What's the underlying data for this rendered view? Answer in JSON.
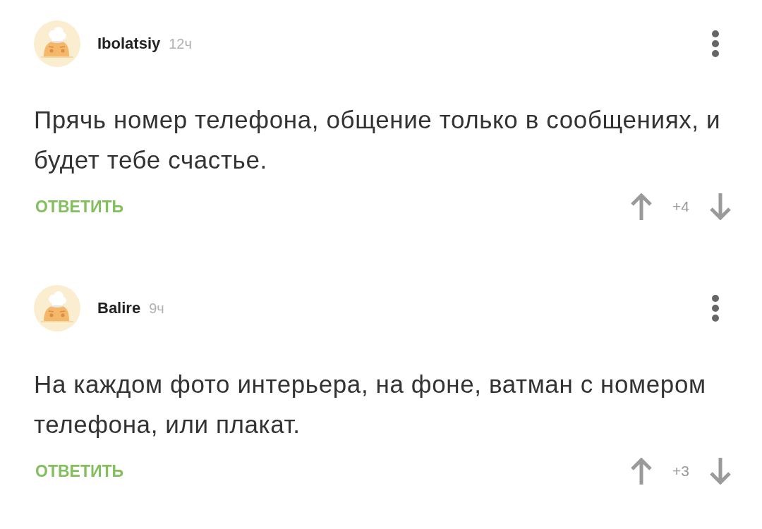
{
  "comments": [
    {
      "author": "Ibolatsiy",
      "time": "12ч",
      "text": "Прячь номер телефона, общение только в сообщениях, и будет тебе счастье.",
      "reply_label": "ОТВЕТИТЬ",
      "rating": "+4"
    },
    {
      "author": "Balire",
      "time": "9ч",
      "text": "На каждом фото интерьера, на фоне, ватман с номером телефона, или плакат.",
      "reply_label": "ОТВЕТИТЬ",
      "rating": "+3"
    }
  ]
}
